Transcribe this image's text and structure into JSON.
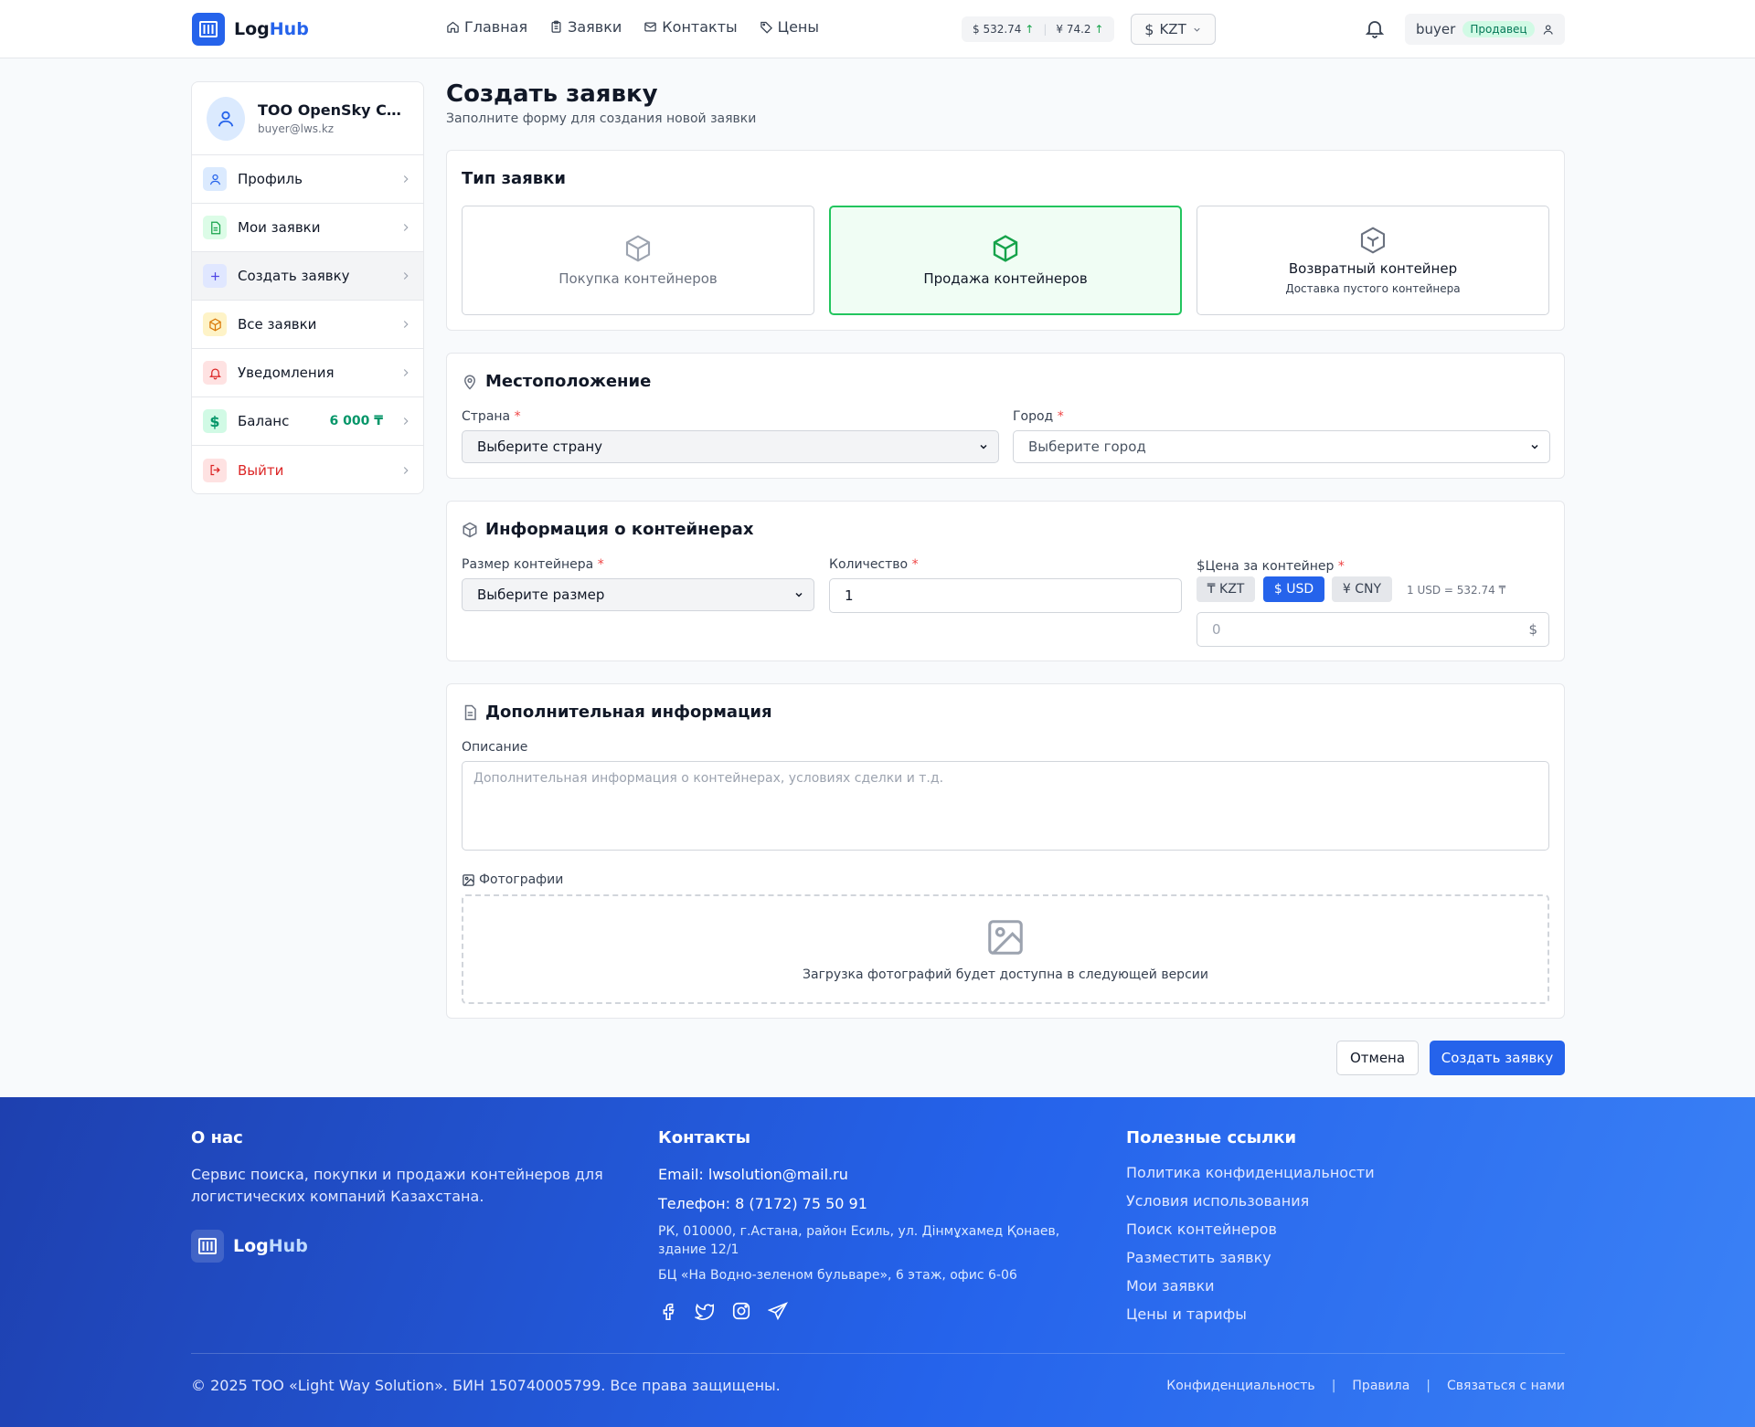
{
  "header": {
    "logo_log": "Log",
    "logo_hub": "Hub",
    "nav": [
      "Главная",
      "Заявки",
      "Контакты",
      "Цены"
    ],
    "rate_usd": "$ 532.74",
    "rate_cny": "¥ 74.2",
    "rate_arrow": "↑",
    "currency": "KZT",
    "username": "buyer",
    "role": "Продавец"
  },
  "sidebar": {
    "company": "ТОО OpenSky Container",
    "email": "buyer@lws.kz",
    "items": [
      {
        "label": "Профиль"
      },
      {
        "label": "Мои заявки"
      },
      {
        "label": "Создать заявку"
      },
      {
        "label": "Все заявки"
      },
      {
        "label": "Уведомления"
      },
      {
        "label": "Баланс",
        "value": "6 000 ₸"
      },
      {
        "label": "Выйти"
      }
    ]
  },
  "page": {
    "title": "Создать заявку",
    "subtitle": "Заполните форму для создания новой заявки"
  },
  "type_card": {
    "title": "Тип заявки",
    "options": [
      {
        "label": "Покупка контейнеров"
      },
      {
        "label": "Продажа контейнеров"
      },
      {
        "label": "Возвратный контейнер",
        "sub": "Доставка пустого контейнера"
      }
    ],
    "selected_index": 1
  },
  "location_card": {
    "title": "Местоположение",
    "country_label": "Страна",
    "country_value": "Выберите страну",
    "city_label": "Город",
    "city_value": "Выберите город",
    "required": "*"
  },
  "container_card": {
    "title": "Информация о контейнерах",
    "size_label": "Размер контейнера",
    "size_value": "Выберите размер",
    "qty_label": "Количество",
    "qty_value": "1",
    "price_label": "Цена за контейнер",
    "currencies": [
      "₸ KZT",
      "$ USD",
      "¥ CNY"
    ],
    "active_currency": "$ USD",
    "rate_note": "1 USD = 532.74 ₸",
    "price_placeholder": "0",
    "price_suffix": "$"
  },
  "extra_card": {
    "title": "Дополнительная информация",
    "desc_label": "Описание",
    "desc_placeholder": "Дополнительная информация о контейнерах, условиях сделки и т.д.",
    "photos_label": "Фотографии",
    "upload_text": "Загрузка фотографий будет доступна в следующей версии"
  },
  "actions": {
    "cancel": "Отмена",
    "submit": "Создать заявку"
  },
  "footer": {
    "about_title": "О нас",
    "about_text": "Сервис поиска, покупки и продажи контейнеров для логистических компаний Казахстана.",
    "contacts_title": "Контакты",
    "email": "Email: lwsolution@mail.ru",
    "phone": "Телефон: 8 (7172) 75 50 91",
    "address1": "РК, 010000, г.Астана, район Есиль, ул. Дінмұхамед Қонаев, здание 12/1",
    "address2": "БЦ «На Водно-зеленом бульваре», 6 этаж, офис 6-06",
    "links_title": "Полезные ссылки",
    "links": [
      "Политика конфиденциальности",
      "Условия использования",
      "Поиск контейнеров",
      "Разместить заявку",
      "Мои заявки",
      "Цены и тарифы"
    ],
    "copyright": "© 2025 ТОО «Light Way Solution». БИН 150740005799. Все права защищены.",
    "bottom_links": [
      "Конфиденциальность",
      "Правила",
      "Связаться с нами"
    ],
    "pipe": "|"
  },
  "colors": {
    "primary": "#2563eb",
    "success": "#22c55e",
    "danger": "#dc2626"
  }
}
